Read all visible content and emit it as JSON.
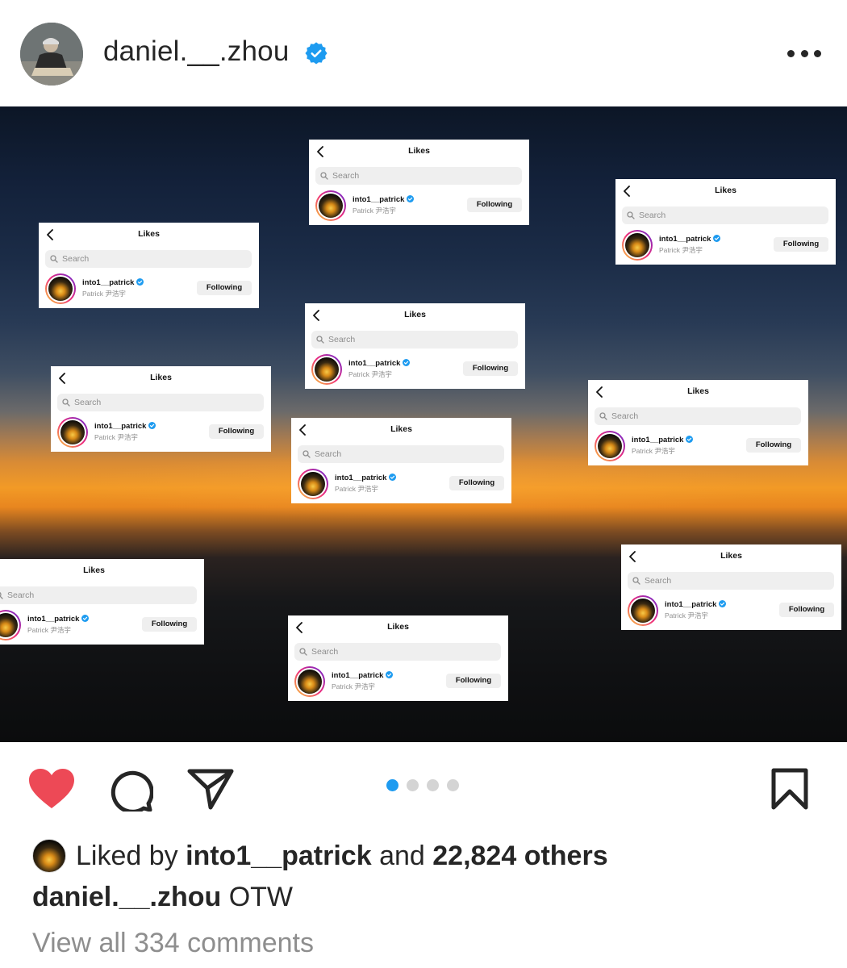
{
  "post": {
    "username": "daniel.__.zhou",
    "verified": true
  },
  "likes_card": {
    "title": "Likes",
    "search_placeholder": "Search",
    "handle": "into1__patrick",
    "subname": "Patrick 尹浩宇",
    "button": "Following"
  },
  "carousel": {
    "count": 4,
    "active": 0
  },
  "likes": {
    "prefix": "Liked by ",
    "liker": "into1__patrick",
    "mid": " and ",
    "others": "22,824 others"
  },
  "caption": {
    "user": "daniel.__.zhou",
    "text": " OTW"
  },
  "comments": {
    "label": "View all 334 comments"
  },
  "colors": {
    "heart": "#ed4956",
    "accent_dot": "#1e9bf0",
    "verified": "#1d9bf0"
  },
  "icons": [
    "heart-icon",
    "comment-icon",
    "share-icon",
    "bookmark-icon",
    "more-icon",
    "verified-icon",
    "back-chevron-icon",
    "search-icon"
  ]
}
